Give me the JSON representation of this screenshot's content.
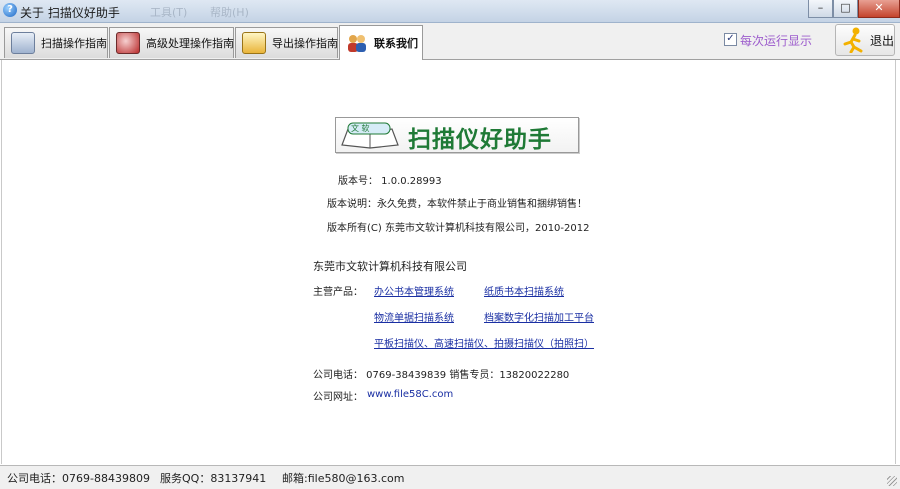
{
  "window": {
    "title": "关于 扫描仪好助手",
    "ghost_items": [
      "工具(T)",
      "帮助(H)"
    ],
    "controls": {
      "minimize": "–",
      "maximize": "□",
      "close": "✕"
    }
  },
  "tabs": [
    {
      "label": "扫描操作指南",
      "icon": "scanner-icon"
    },
    {
      "label": "高级处理操作指南",
      "icon": "process-icon"
    },
    {
      "label": "导出操作指南",
      "icon": "export-icon"
    },
    {
      "label": "联系我们",
      "icon": "contacts-icon",
      "active": true
    }
  ],
  "toolbar": {
    "startup_checkbox_label": "每次运行显示",
    "startup_checked": true,
    "exit_label": "退出",
    "checkmark": "✓"
  },
  "about": {
    "logo_badge": "文 软",
    "logo_text": "扫描仪好助手",
    "version": "版本号：  1.0.0.28993",
    "statement": "版本说明：永久免费，本软件禁止于商业销售和捆绑销售！",
    "copyright": "版本所有(C) 东莞市文软计算机科技有限公司，2010-2012"
  },
  "company": {
    "name": "东莞市文软计算机科技有限公司",
    "products_label": "主营产品：",
    "products": [
      "办公书本管理系统",
      "纸质书本扫描系统",
      "物流单据扫描系统",
      "档案数字化扫描加工平台",
      "平板扫描仪、高速扫描仪、拍摄扫描仪（拍照扫）"
    ],
    "phone_line": "公司电话：  0769-38439839    销售专员：13820022280",
    "website_label": "公司网址：",
    "website": "www.file58C.com"
  },
  "statusbar": {
    "phone": "公司电话：0769-88439809",
    "qq": "服务QQ：83137941",
    "email": "邮箱:file580@163.com"
  },
  "colors": {
    "link": "#1a2fa3",
    "checkbox_label": "#9d5dcd",
    "logo_text": "#1f7a36"
  }
}
